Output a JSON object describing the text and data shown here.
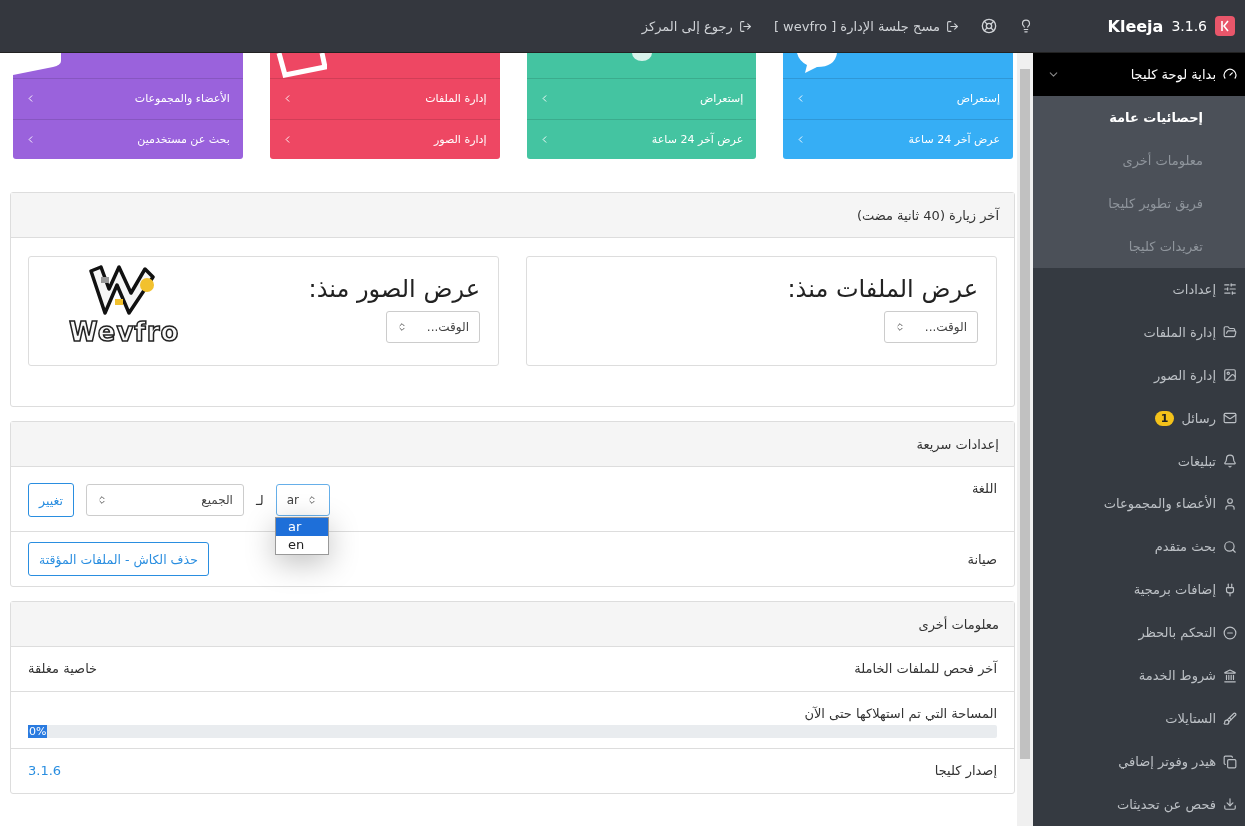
{
  "topbar": {
    "brand": "Kleeja",
    "version": "3.1.6",
    "links": [
      {
        "label": "مسح جلسة الإدارة [ wevfro ]"
      },
      {
        "label": "رجوع إلى المركز"
      }
    ]
  },
  "cards": [
    {
      "color": "#36aef5",
      "links": [
        "إستعراض",
        "عرض آخر 24 ساعة"
      ]
    },
    {
      "color": "#44c4a1",
      "links": [
        "إستعراض",
        "عرض آخر 24 ساعة"
      ]
    },
    {
      "color": "#ee4763",
      "links": [
        "إدارة الملفات",
        "إدارة الصور"
      ]
    },
    {
      "color": "#9a62dc",
      "links": [
        "الأعضاء والمجموعات",
        "بحث عن مستخدمين"
      ]
    }
  ],
  "stats_panel": {
    "title": "آخر زيارة (40 ثانية مضت)",
    "boxes": [
      {
        "kind": "plain",
        "heading": "عرض الملفات منذ:",
        "select": "الوقت..."
      },
      {
        "kind": "logo",
        "heading": "عرض الصور منذ:",
        "select": "الوقت...",
        "logo_text": "Wevfro"
      }
    ]
  },
  "quick_settings": {
    "title": "إعدادات سريعة",
    "language": {
      "label": "اللغة",
      "select": "ar",
      "options": [
        {
          "label": "ar",
          "selected": true
        },
        {
          "label": "en",
          "selected": false
        }
      ],
      "open": true,
      "for_label": "لـ",
      "target": "الجميع",
      "button": "تغيير"
    },
    "maintenance": {
      "label": "صيانة",
      "button": "حذف الكاش - الملفات المؤقتة"
    }
  },
  "other_info": {
    "title": "معلومات أخرى",
    "rows": [
      {
        "kind": "pair",
        "label": "آخر فحص للملفات الخاملة",
        "value": "خاصية مغلقة"
      },
      {
        "kind": "progress",
        "label": "المساحة التي تم استهلاكها حتى الآن",
        "level": 0,
        "reading": "0%"
      },
      {
        "kind": "link",
        "label": "إصدار كليجا",
        "value": "3.1.6"
      }
    ]
  },
  "sidebar": {
    "items": [
      {
        "label": "بداية لوحة كليجا",
        "expanded": true,
        "children": [
          {
            "label": "إحصائيات عامة",
            "selected": true
          },
          {
            "label": "معلومات أخرى",
            "selected": false
          },
          {
            "label": "فريق تطوير كليجا",
            "selected": false
          },
          {
            "label": "تغريدات كليجا",
            "selected": false
          }
        ]
      },
      {
        "label": "إعدادات"
      },
      {
        "label": "إدارة الملفات"
      },
      {
        "label": "إدارة الصور"
      },
      {
        "label": "رسائل",
        "badge": "1"
      },
      {
        "label": "تبليغات"
      },
      {
        "label": "الأعضاء والمجموعات"
      },
      {
        "label": "بحث متقدم"
      },
      {
        "label": "إضافات برمجية"
      },
      {
        "label": "التحكم بالحظر"
      },
      {
        "label": "شروط الخدمة"
      },
      {
        "label": "الستايلات"
      },
      {
        "label": "هيدر وفوتر إضافي"
      },
      {
        "label": "فحص عن تحديثات"
      }
    ]
  }
}
